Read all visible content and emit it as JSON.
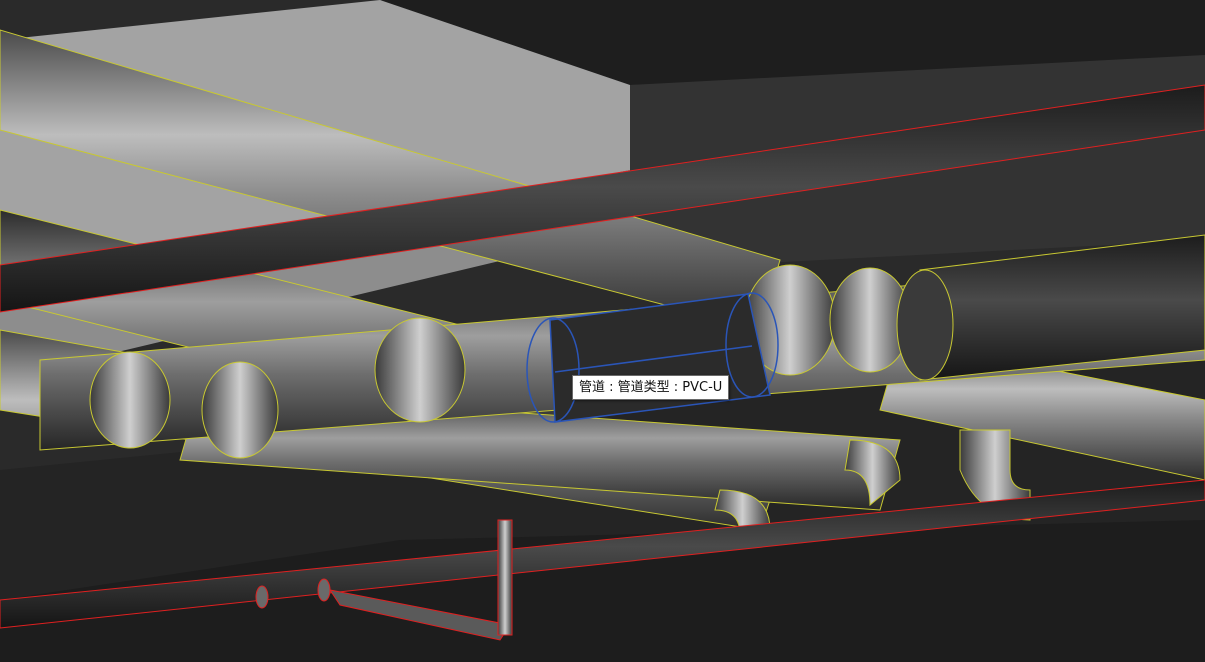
{
  "tooltip": {
    "text": "管道 : 管道类型 : PVC-U"
  },
  "colors": {
    "background": "#2a2a2a",
    "ceiling_block": "#9a9a9a",
    "pipe_edge": "#c8c832",
    "selected_pipe": "#2a55b8",
    "hot_line": "#e02020"
  }
}
